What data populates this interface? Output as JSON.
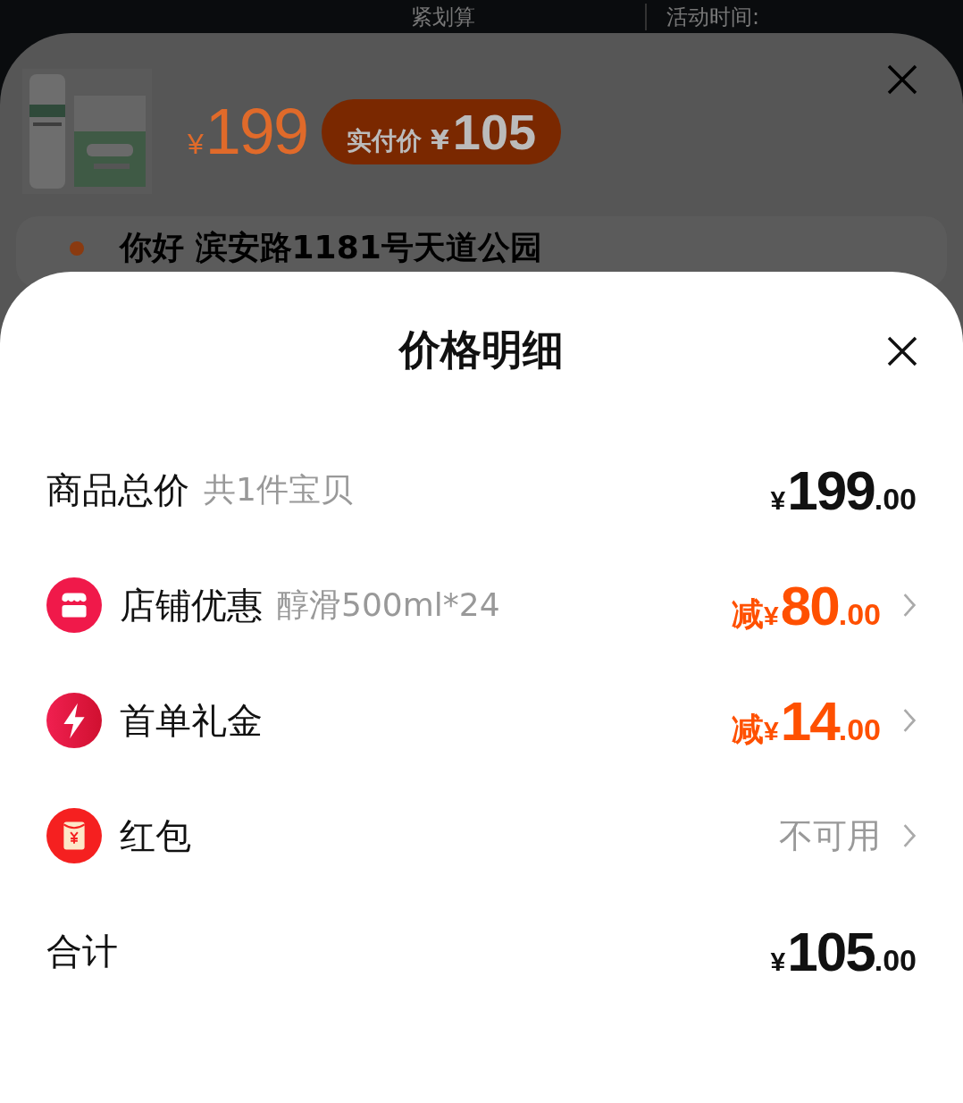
{
  "top_strip": {
    "promo_fragment": "紧划算",
    "time_label": "活动时间:"
  },
  "product_card": {
    "price_currency": "¥",
    "price": "199",
    "actual_label": "实付价",
    "actual_currency": "¥",
    "actual_price": "105"
  },
  "address": {
    "text": "你好 滨安路1181号天道公园"
  },
  "price_detail": {
    "title": "价格明细",
    "rows": [
      {
        "kind": "amount",
        "label": "商品总价",
        "note": "共1件宝贝",
        "currency": "¥",
        "integer": "199",
        "decimal": ".00"
      },
      {
        "kind": "discount",
        "label": "店铺优惠",
        "note": "醇滑500ml*24",
        "prefix": "减",
        "currency": "¥",
        "integer": "80",
        "decimal": ".00"
      },
      {
        "kind": "discount",
        "label": "首单礼金",
        "prefix": "减",
        "currency": "¥",
        "integer": "14",
        "decimal": ".00"
      },
      {
        "kind": "status",
        "label": "红包",
        "status": "不可用"
      },
      {
        "kind": "amount",
        "label": "合计",
        "currency": "¥",
        "integer": "105",
        "decimal": ".00"
      }
    ]
  }
}
